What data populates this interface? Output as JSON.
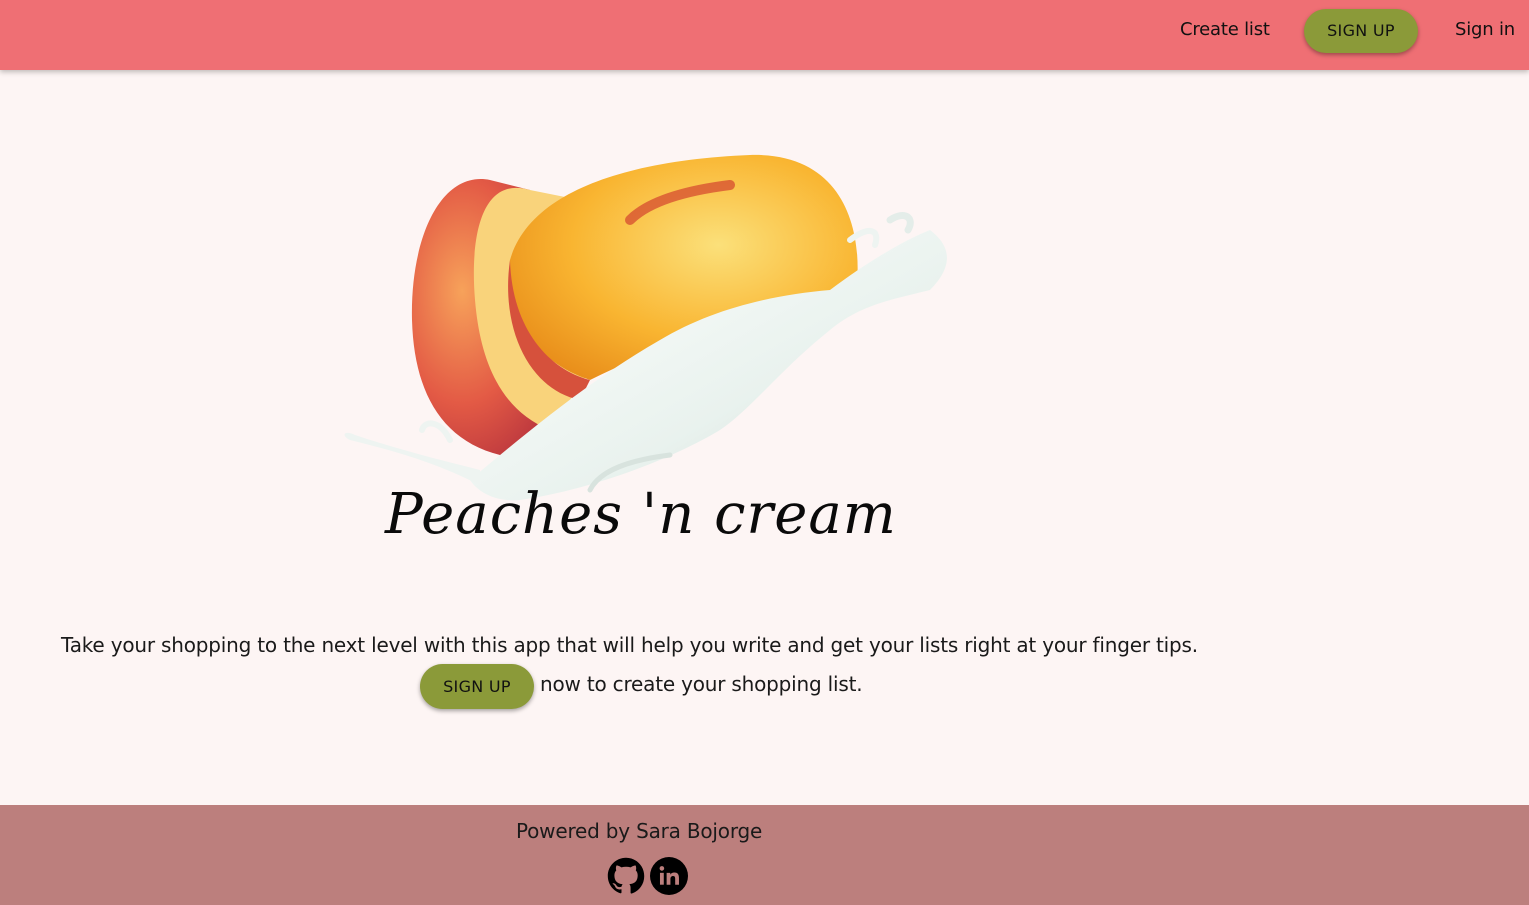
{
  "nav": {
    "create_list": "Create list",
    "sign_up": "SIGN UP",
    "sign_in": "Sign in"
  },
  "hero": {
    "title": "Peaches 'n cream",
    "image": "peach-with-cream-splash"
  },
  "main": {
    "tagline": "Take your shopping to the next level with this app that will help you write and get your lists right at your finger tips.",
    "cta_button": "SIGN UP",
    "cta_text": "now to create your shopping list."
  },
  "footer": {
    "powered_by": "Powered by Sara Bojorge",
    "icons": [
      "github-icon",
      "linkedin-icon"
    ]
  },
  "colors": {
    "navbar": "#ef6f74",
    "background": "#fdf5f4",
    "button": "#8b9a39",
    "footer": "#bc7f7d"
  }
}
